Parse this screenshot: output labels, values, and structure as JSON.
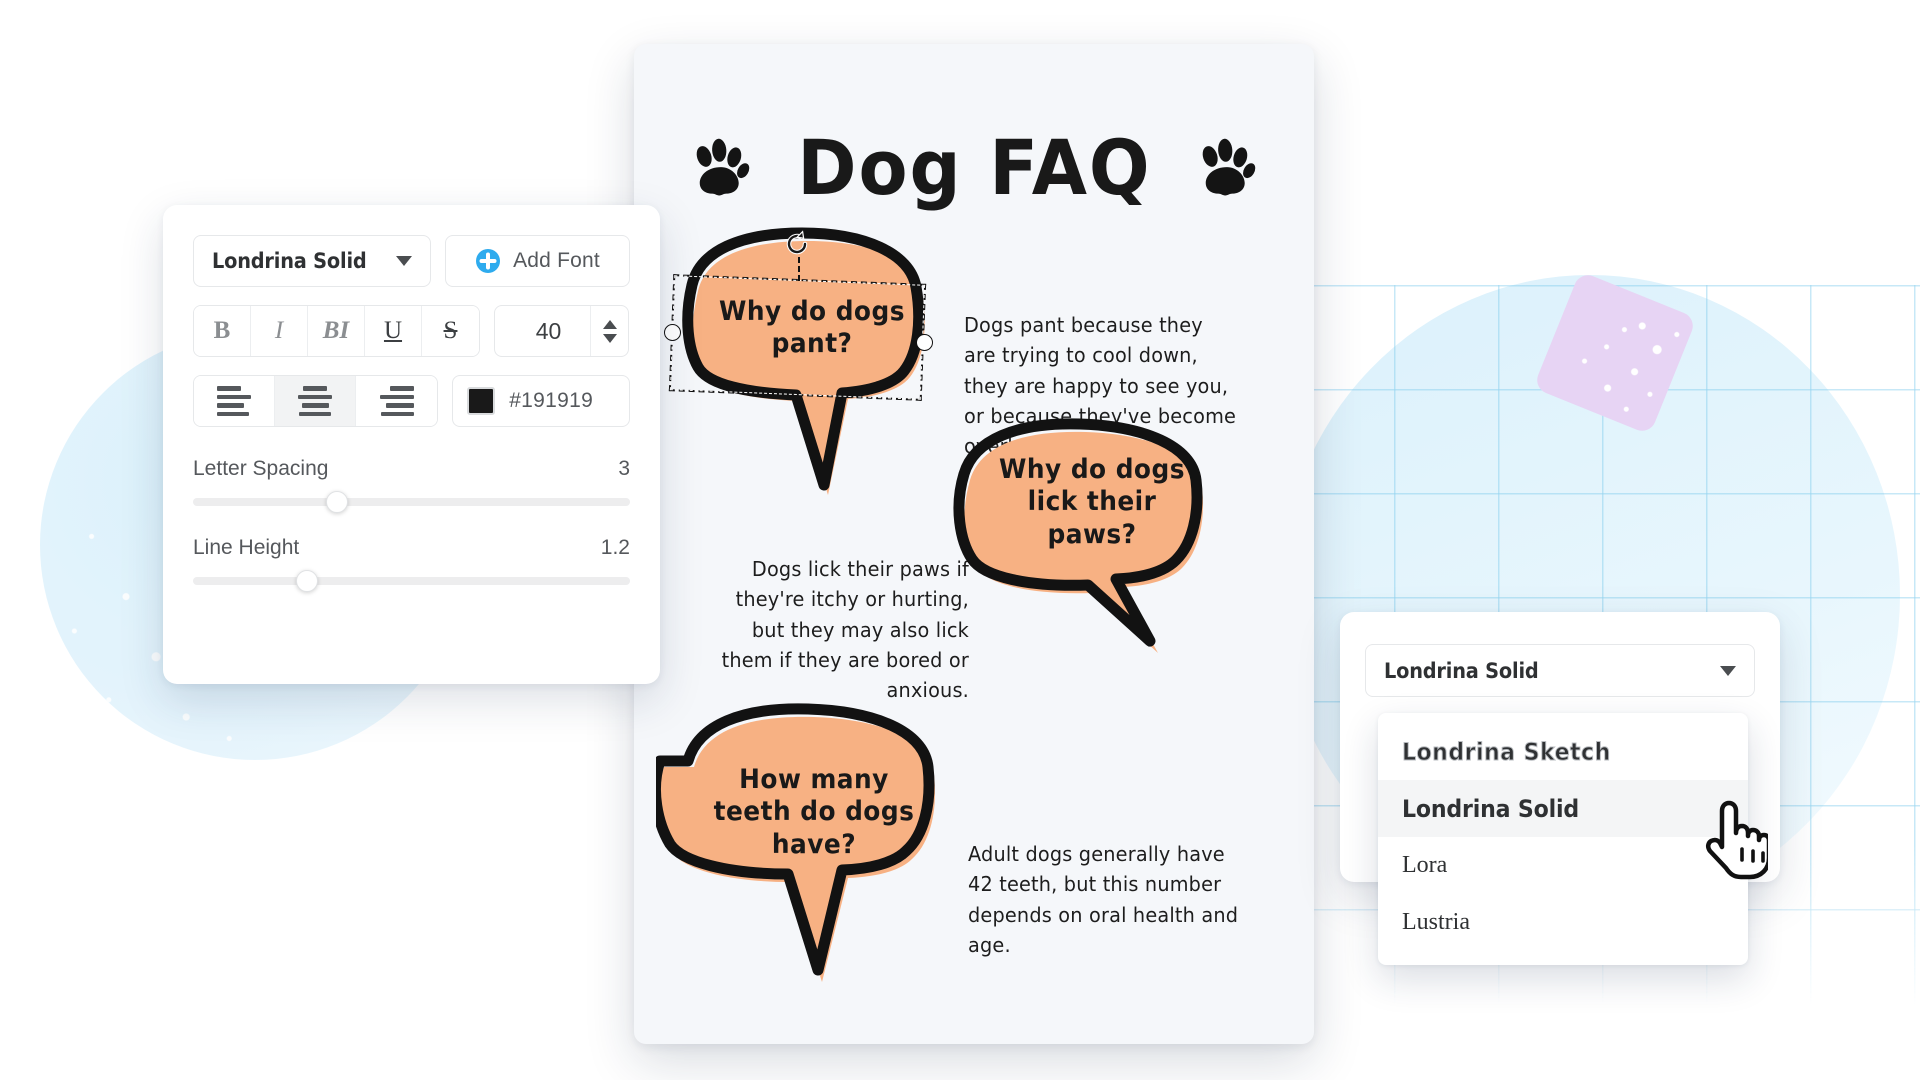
{
  "text_panel": {
    "font_select": {
      "value": "Londrina Solid",
      "caret_icon": "chevron-down-icon"
    },
    "add_font_button": {
      "label": "Add Font",
      "icon": "plus-circle-icon"
    },
    "style_buttons": [
      {
        "name": "bold",
        "glyph": "B"
      },
      {
        "name": "italic",
        "glyph": "I"
      },
      {
        "name": "bold-italic",
        "glyph": "BI"
      },
      {
        "name": "underline",
        "glyph": "U"
      },
      {
        "name": "strikethrough",
        "glyph": "S"
      }
    ],
    "font_size": {
      "value": "40",
      "increment_icon": "triangle-up-icon",
      "decrement_icon": "triangle-down-icon"
    },
    "align_buttons": [
      {
        "name": "align-left",
        "icon": "align-left-icon",
        "active": false
      },
      {
        "name": "align-center",
        "icon": "align-center-icon",
        "active": true
      },
      {
        "name": "align-right",
        "icon": "align-right-icon",
        "active": false
      }
    ],
    "color": {
      "hex": "#191919",
      "swatch": "#191919"
    },
    "sliders": [
      {
        "label": "Letter Spacing",
        "value": "3",
        "percent": 33
      },
      {
        "label": "Line Height",
        "value": "1.2",
        "percent": 26
      }
    ]
  },
  "font_dropdown": {
    "select_value": "Londrina Solid",
    "caret_icon": "chevron-down-icon",
    "options": [
      {
        "label": "Londrina Sketch",
        "style": "sketch",
        "highlighted": false
      },
      {
        "label": "Londrina Solid",
        "style": "solid",
        "highlighted": true
      },
      {
        "label": "Lora",
        "style": "serif",
        "highlighted": false
      },
      {
        "label": "Lustria",
        "style": "serif",
        "highlighted": false
      }
    ],
    "cursor_icon": "pointing-hand-cursor"
  },
  "canvas": {
    "title": "Dog FAQ",
    "paw_icon_left": "paw-print-icon",
    "paw_icon_right": "paw-print-icon",
    "selection": {
      "rotate_icon": "rotate-handle-icon",
      "handle_left": "resize-handle",
      "handle_right": "resize-handle"
    },
    "bubbles": [
      {
        "id": "pant",
        "line1": "Why do dogs",
        "line2": "pant?",
        "selected": true
      },
      {
        "id": "lick",
        "line1": "Why do dogs",
        "line2": "lick their",
        "line3": "paws?",
        "selected": false
      },
      {
        "id": "teeth",
        "line1": "How many",
        "line2": "teeth do dogs",
        "line3": "have?",
        "selected": false
      }
    ],
    "answers": [
      {
        "id": "pant-answer",
        "text": "Dogs pant because they are trying to cool down, they are happy to see you, or because they've become overheated."
      },
      {
        "id": "lick-answer",
        "text": "Dogs lick their paws if they're itchy or hurting, but they may also lick them if they are bored or anxious."
      },
      {
        "id": "teeth-answer",
        "text": "Adult dogs generally have 42 teeth, but this number depends on oral health and age."
      }
    ]
  },
  "colors": {
    "bubble_fill": "#f7b183",
    "bubble_stroke": "#121212",
    "accent_blue": "#2eabee",
    "text_dark": "#191919",
    "decor_purple": "#e7d4f4",
    "decor_blue": "#d9f0fb"
  }
}
